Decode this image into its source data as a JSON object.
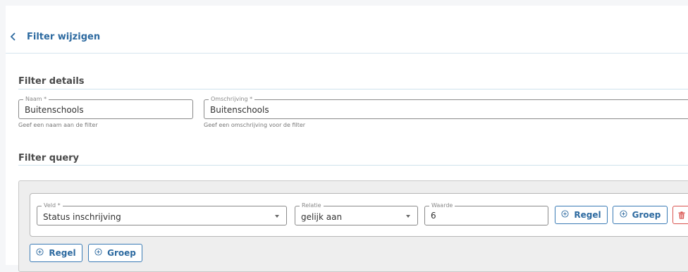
{
  "header": {
    "title": "Filter wijzigen",
    "back_icon": "chevron-left-icon"
  },
  "details": {
    "title": "Filter details",
    "naam": {
      "label": "Naam *",
      "value": "Buitenschools",
      "hint": "Geef een naam aan de filter"
    },
    "omschrijving": {
      "label": "Omschrijving *",
      "value": "Buitenschools",
      "hint": "Geef een omschrijving voor de filter"
    }
  },
  "query": {
    "title": "Filter query",
    "rule": {
      "veld": {
        "label": "Veld *",
        "value": "Status inschrijving"
      },
      "relatie": {
        "label": "Relatie",
        "value": "gelijk aan"
      },
      "waarde": {
        "label": "Waarde",
        "value": "6"
      },
      "add_rule_label": "Regel",
      "add_group_label": "Groep"
    },
    "add_rule_label": "Regel",
    "add_group_label": "Groep"
  },
  "colors": {
    "accent": "#2d6aa0",
    "danger": "#d9534f",
    "divider": "#cfe2ec"
  }
}
